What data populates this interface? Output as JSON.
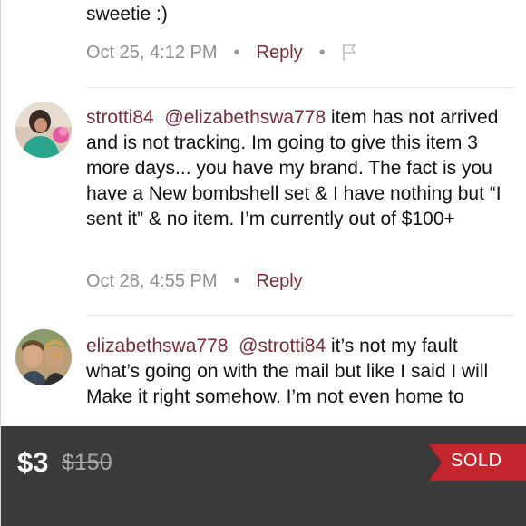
{
  "comments": [
    {
      "text_tail": "sweetie :)",
      "timestamp": "Oct 25, 4:12 PM",
      "reply_label": "Reply",
      "separator": "•",
      "flag_icon": "flag-icon"
    },
    {
      "username": "strotti84",
      "mention": "@elizabethswa778",
      "text": "item has not arrived and is not tracking. Im going to give this item 3 more days... you have my brand. The fact is you have a New bombshell set & I have nothing but “I sent it”  & no item. I’m currently out of $100+",
      "timestamp": "Oct 28, 4:55 PM",
      "reply_label": "Reply",
      "separator": "•"
    },
    {
      "username": "elizabethswa778",
      "mention": "@strotti84",
      "text": "it’s not my fault what’s going on with the mail but like I said I will\nMake it right somehow. I’m not even home to"
    }
  ],
  "listing": {
    "price": "$3",
    "original_price": "$150",
    "status": "SOLD"
  },
  "colors": {
    "accent": "#7b2b3a",
    "sold_red": "#c4262e",
    "bar": "#3a3a3a"
  }
}
